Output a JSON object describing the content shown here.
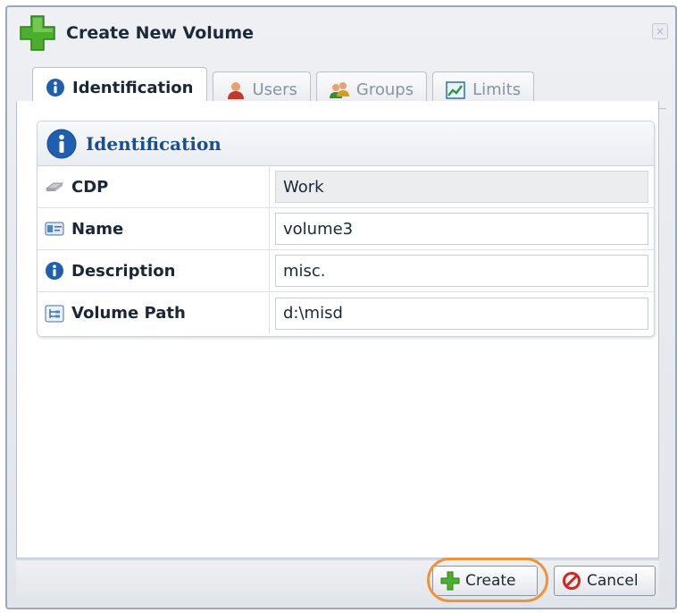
{
  "dialog": {
    "title": "Create New Volume",
    "close_label": "×"
  },
  "tabs": [
    {
      "label": "Identification",
      "icon": "info-icon",
      "active": true
    },
    {
      "label": "Users",
      "icon": "user-icon",
      "active": false
    },
    {
      "label": "Groups",
      "icon": "group-icon",
      "active": false
    },
    {
      "label": "Limits",
      "icon": "chart-icon",
      "active": false
    }
  ],
  "section": {
    "title": "Identification",
    "icon": "info-icon"
  },
  "fields": [
    {
      "label": "CDP",
      "value": "Work",
      "icon": "disk-icon",
      "readonly": true
    },
    {
      "label": "Name",
      "value": "volume3",
      "icon": "id-card-icon",
      "readonly": false
    },
    {
      "label": "Description",
      "value": "misc.",
      "icon": "info-icon",
      "readonly": false
    },
    {
      "label": "Volume Path",
      "value": "d:\\misd",
      "icon": "tree-icon",
      "readonly": false
    }
  ],
  "buttons": {
    "create": "Create",
    "cancel": "Cancel"
  },
  "colors": {
    "accent_orange": "#f0923a",
    "section_title": "#1b4e8c",
    "info_blue": "#1f5fb0",
    "plus_green": "#4cae2f"
  }
}
